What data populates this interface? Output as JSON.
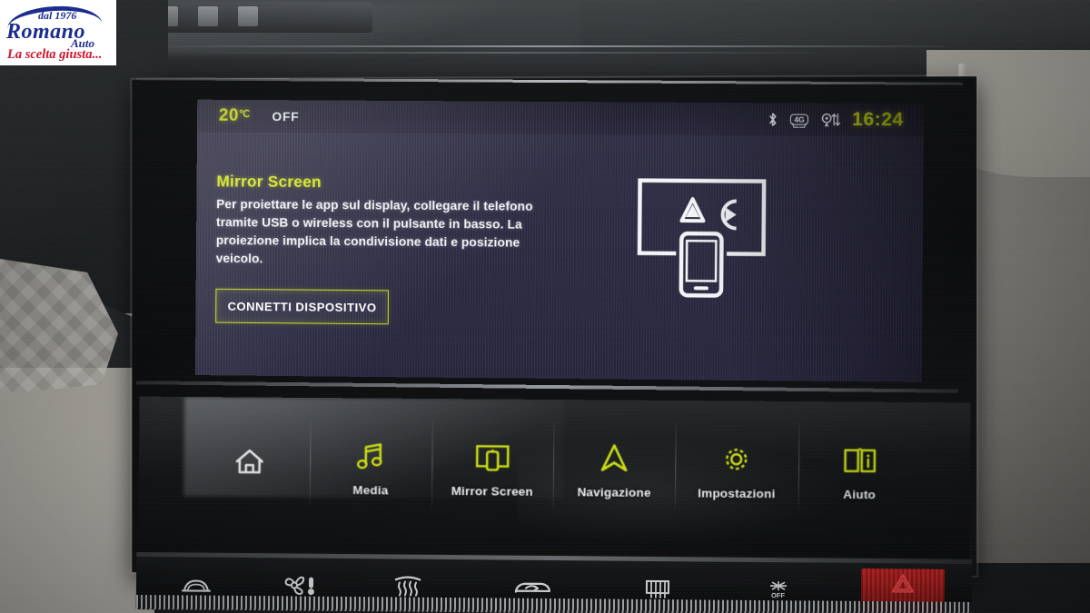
{
  "watermark": {
    "since": "dal 1976",
    "brand": "Romano",
    "sub": "Auto",
    "tagline": "La scelta giusta..."
  },
  "status_bar": {
    "temperature": "20",
    "temperature_unit": "℃",
    "climate_state": "OFF",
    "clock": "16:24",
    "icons": [
      "bluetooth-icon",
      "4g-icon",
      "location-data-icon"
    ],
    "network_label": "4G",
    "accent_color": "#c8dc12"
  },
  "screen": {
    "title": "Mirror Screen",
    "body": "Per proiettare le app sul display, collegare il telefono tramite USB o wireless con il pulsante in basso. La proiezione implica la condivisione dati e posizione veicolo.",
    "button_label": "CONNETTI DISPOSITIVO",
    "illustration": "screen-mirroring-illustration",
    "accent_color": "#d2e61d",
    "background_color": "#2b2940"
  },
  "navbar": {
    "items": [
      {
        "label": "",
        "icon": "home-icon",
        "active": false
      },
      {
        "label": "Media",
        "icon": "music-note-icon",
        "active": false
      },
      {
        "label": "Mirror Screen",
        "icon": "screen-cast-icon",
        "active": true
      },
      {
        "label": "Navigazione",
        "icon": "navigation-arrow-icon",
        "active": false
      },
      {
        "label": "Impostazioni",
        "icon": "gear-icon",
        "active": false
      },
      {
        "label": "Aiuto",
        "icon": "help-book-icon",
        "active": false
      }
    ],
    "icon_color": "#c8dc12",
    "home_icon_color": "#f2f3f6"
  },
  "hvac_bar": {
    "buttons": [
      {
        "name": "front-demist-button",
        "label": ""
      },
      {
        "name": "fan-temp-button",
        "label": ""
      },
      {
        "name": "rear-demist-button",
        "label": ""
      },
      {
        "name": "air-recirculation-button",
        "label": ""
      },
      {
        "name": "rear-window-heater-button",
        "label": ""
      },
      {
        "name": "climate-off-button",
        "label": "OFF"
      },
      {
        "name": "hazard-lights-button",
        "label": ""
      }
    ],
    "hazard_color": "#d61f1f"
  }
}
